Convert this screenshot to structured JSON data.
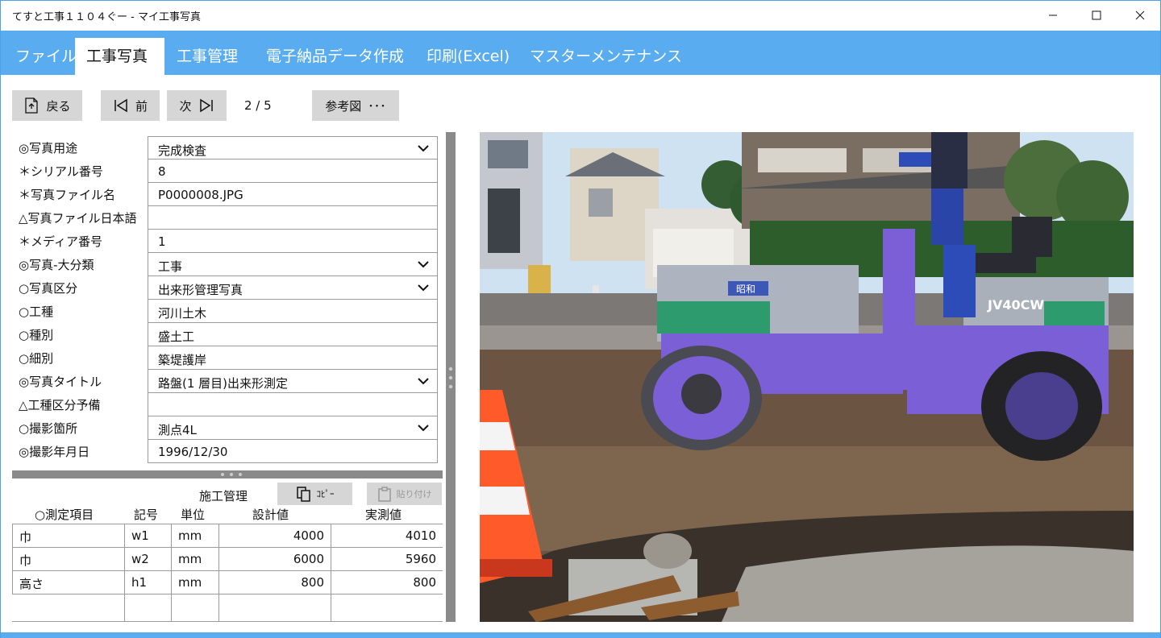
{
  "window": {
    "title": "てすと工事１１０４ぐー - マイ工事写真"
  },
  "menu": {
    "tabs": [
      {
        "label": "ファイル"
      },
      {
        "label": "工事写真"
      },
      {
        "label": "工事管理"
      },
      {
        "label": "電子納品データ作成"
      },
      {
        "label": "印刷(Excel)"
      },
      {
        "label": "マスターメンテナンス"
      }
    ],
    "active_index": 1
  },
  "toolbar": {
    "back_label": "戻る",
    "prev_label": "前",
    "next_label": "次",
    "page_indicator": "2 / 5",
    "reference_label": "参考図",
    "more_label": "･･･"
  },
  "form": {
    "fields": [
      {
        "label": "◎写真用途",
        "value": "完成検査",
        "dropdown": true
      },
      {
        "label": "＊シリアル番号",
        "value": "8",
        "dropdown": false
      },
      {
        "label": "＊写真ファイル名",
        "value": "P0000008.JPG",
        "dropdown": false
      },
      {
        "label": "△写真ファイル日本語",
        "value": "",
        "dropdown": false
      },
      {
        "label": "＊メディア番号",
        "value": "1",
        "dropdown": false
      },
      {
        "label": "◎写真-大分類",
        "value": "工事",
        "dropdown": true
      },
      {
        "label": "○写真区分",
        "value": "出来形管理写真",
        "dropdown": true
      },
      {
        "label": "○工種",
        "value": "河川土木",
        "dropdown": false
      },
      {
        "label": "○種別",
        "value": "盛土工",
        "dropdown": false
      },
      {
        "label": "○細別",
        "value": "築堤護岸",
        "dropdown": false
      },
      {
        "label": "◎写真タイトル",
        "value": "路盤(1 層目)出来形測定",
        "dropdown": true
      },
      {
        "label": "△工種区分予備",
        "value": "",
        "dropdown": false
      },
      {
        "label": "○撮影箇所",
        "value": "測点4L",
        "dropdown": true
      },
      {
        "label": "◎撮影年月日",
        "value": "1996/12/30",
        "dropdown": false
      }
    ]
  },
  "construction_management": {
    "title": "施工管理",
    "copy_label": "ｺﾋﾟｰ",
    "paste_label": "貼り付け",
    "headers": [
      "○測定項目",
      "記号",
      "単位",
      "設計値",
      "実測値"
    ],
    "rows": [
      {
        "item": "巾",
        "symbol": "w1",
        "unit": "mm",
        "design": "4000",
        "actual": "4010"
      },
      {
        "item": "巾",
        "symbol": "w2",
        "unit": "mm",
        "design": "6000",
        "actual": "5960"
      },
      {
        "item": "高さ",
        "symbol": "h1",
        "unit": "mm",
        "design": "800",
        "actual": "800"
      },
      {
        "item": "",
        "symbol": "",
        "unit": "",
        "design": "",
        "actual": ""
      }
    ]
  },
  "photo": {
    "roller_text": "JV40CW",
    "brand_text": "昭和"
  },
  "colors": {
    "accent": "#5aacf0",
    "button_bg": "#d6d6d6",
    "roller": "#7b5fd6",
    "cone": "#ff5a2a"
  }
}
